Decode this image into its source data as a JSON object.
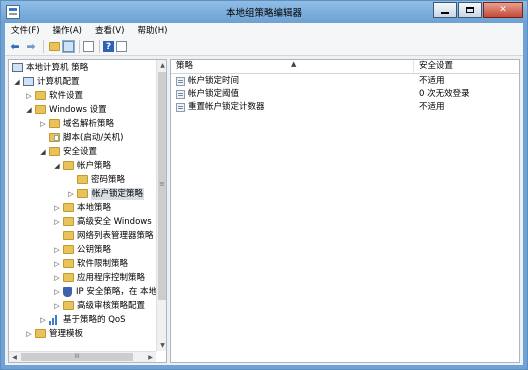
{
  "window": {
    "title": "本地组策略编辑器"
  },
  "menu": [
    "文件(F)",
    "操作(A)",
    "查看(V)",
    "帮助(H)"
  ],
  "toolbar": {
    "icons": [
      "back-icon",
      "forward-icon",
      "up-folder-icon",
      "show-hide-tree-icon",
      "export-list-icon",
      "help-icon",
      "properties-icon"
    ],
    "help_glyph": "?"
  },
  "tree": [
    {
      "label": "本地计算机 策略",
      "icon": "computer-policy-icon",
      "expander": ""
    },
    {
      "label": "计算机配置",
      "icon": "computer-icon",
      "expander": "◢"
    },
    {
      "label": "软件设置",
      "icon": "folder-icon",
      "expander": "▷"
    },
    {
      "label": "Windows 设置",
      "icon": "folder-icon",
      "expander": "◢"
    },
    {
      "label": "域名解析策略",
      "icon": "folder-icon",
      "expander": "▷"
    },
    {
      "label": "脚本(启动/关机)",
      "icon": "document-icon",
      "expander": ""
    },
    {
      "label": "安全设置",
      "icon": "folder-icon",
      "expander": "◢"
    },
    {
      "label": "帐户策略",
      "icon": "folder-icon",
      "expander": "◢"
    },
    {
      "label": "密码策略",
      "icon": "folder-icon",
      "expander": ""
    },
    {
      "label": "帐户锁定策略",
      "icon": "folder-icon",
      "expander": "▷"
    },
    {
      "label": "本地策略",
      "icon": "folder-icon",
      "expander": "▷"
    },
    {
      "label": "高级安全 Windows",
      "icon": "folder-icon",
      "expander": "▷"
    },
    {
      "label": "网络列表管理器策略",
      "icon": "folder-icon",
      "expander": ""
    },
    {
      "label": "公钥策略",
      "icon": "folder-icon",
      "expander": "▷"
    },
    {
      "label": "软件限制策略",
      "icon": "folder-icon",
      "expander": "▷"
    },
    {
      "label": "应用程序控制策略",
      "icon": "folder-icon",
      "expander": "▷"
    },
    {
      "label": "IP 安全策略，在 本地",
      "icon": "shield-icon",
      "expander": "▷"
    },
    {
      "label": "高级审核策略配置",
      "icon": "folder-icon",
      "expander": "▷"
    },
    {
      "label": "基于策略的 QoS",
      "icon": "chart-icon",
      "expander": "▷"
    },
    {
      "label": "管理模板",
      "icon": "folder-icon",
      "expander": "▷"
    }
  ],
  "list": {
    "columns": [
      "策略",
      "安全设置"
    ],
    "rows": [
      {
        "policy": "帐户锁定时间",
        "setting": "不适用"
      },
      {
        "policy": "帐户锁定阈值",
        "setting": "0 次无效登录"
      },
      {
        "policy": "重置帐户锁定计数器",
        "setting": "不适用"
      }
    ]
  }
}
